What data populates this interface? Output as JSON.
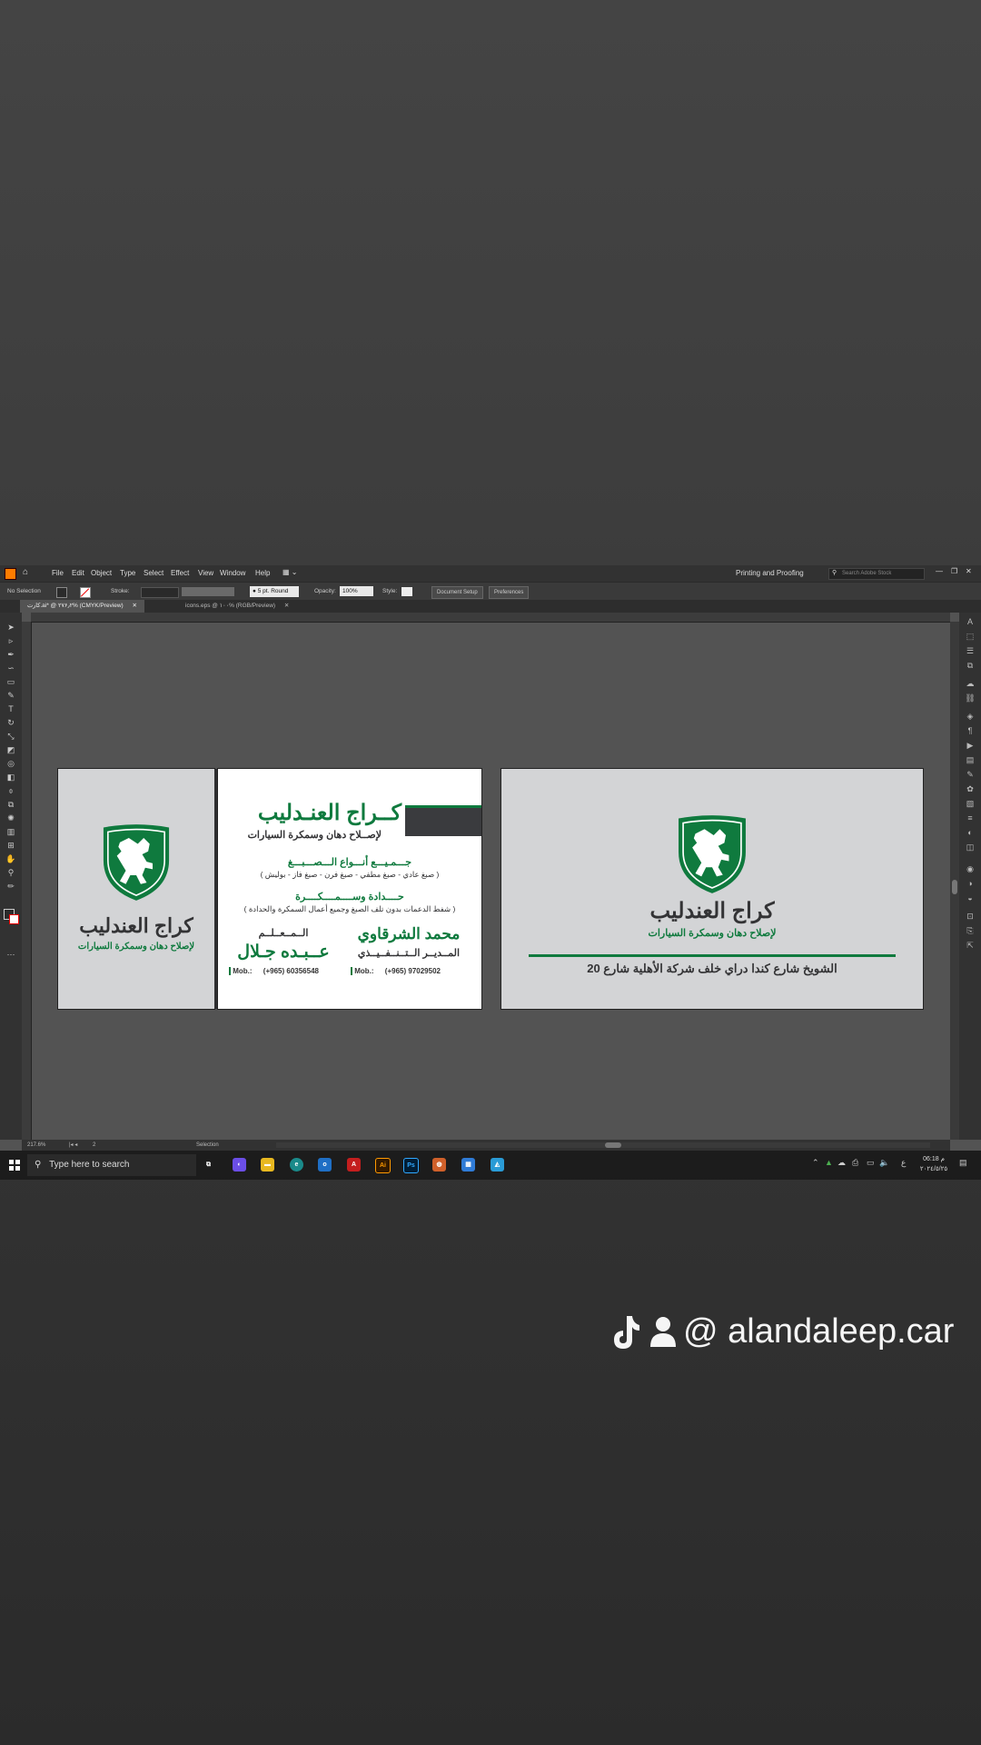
{
  "menu": {
    "items": [
      "File",
      "Edit",
      "Object",
      "Type",
      "Select",
      "Effect",
      "View",
      "Window",
      "Help"
    ],
    "workspace": "Printing and Proofing",
    "search_placeholder": "Search Adobe Stock"
  },
  "options": {
    "selection": "No Selection",
    "stroke_label": "Stroke:",
    "brush": "5 pt. Round",
    "opacity_label": "Opacity:",
    "opacity_value": "100%",
    "style_label": "Style:",
    "doc_setup": "Document Setup",
    "preferences": "Preferences"
  },
  "tabs": [
    {
      "label": "کارت.ai* @ ۲۷۶٫۲% (CMYK/Preview)",
      "active": true
    },
    {
      "label": "icons.eps @ ۱۰۰% (RGB/Preview)",
      "active": false
    }
  ],
  "status": {
    "zoom": "217.6%",
    "page": "2",
    "tool": "Selection"
  },
  "card_logo": {
    "title": "كراج العندليب",
    "subtitle": "لإصلاح دهان وسمكرة السيارات"
  },
  "card_info": {
    "title": "كــراج العنـدليب",
    "subtitle": "لإصــلاح دهان وسمكرة السيارات",
    "service1_title": "جـــمـيـــع أنـــواع الـــصـــبـــغ",
    "service1_detail": "( صبغ عادي - صبغ مطفي - صبغ فرن - صبغ فاز - بوليش )",
    "service2_title": "حــــدادة وســــمــــكــــرة",
    "service2_detail": "( شفط الدعمات بدون تلف الصبغ وجميع أعمال السمكرة والحدادة )",
    "person1_name": "محمد الشرقاوي",
    "person1_role": "المــديــر الــتــنــفــيــذي",
    "person1_mob_label": "Mob.:",
    "person1_mob": "(+965) 97029502",
    "person2_title": "الــمــعــلــم",
    "person2_name": "عــبـده جـلال",
    "person2_mob_label": "Mob.:",
    "person2_mob": "(+965) 60356548"
  },
  "card_back": {
    "title": "كراج العندليب",
    "subtitle": "لإصلاح دهان وسمكرة السيارات",
    "address": "الشويخ شارع كندا دراي خلف شركة الأهلية شارع 20"
  },
  "taskbar": {
    "search_placeholder": "Type here to search",
    "time": "06:18 م",
    "date": "٢٠٢٤/٥/٢٥",
    "lang": "ع"
  },
  "watermark": {
    "handle": "@ alandaleep.car"
  },
  "colors": {
    "brand_green": "#0f7a3e",
    "card_gray": "#d3d4d6",
    "dark_text": "#333335"
  }
}
